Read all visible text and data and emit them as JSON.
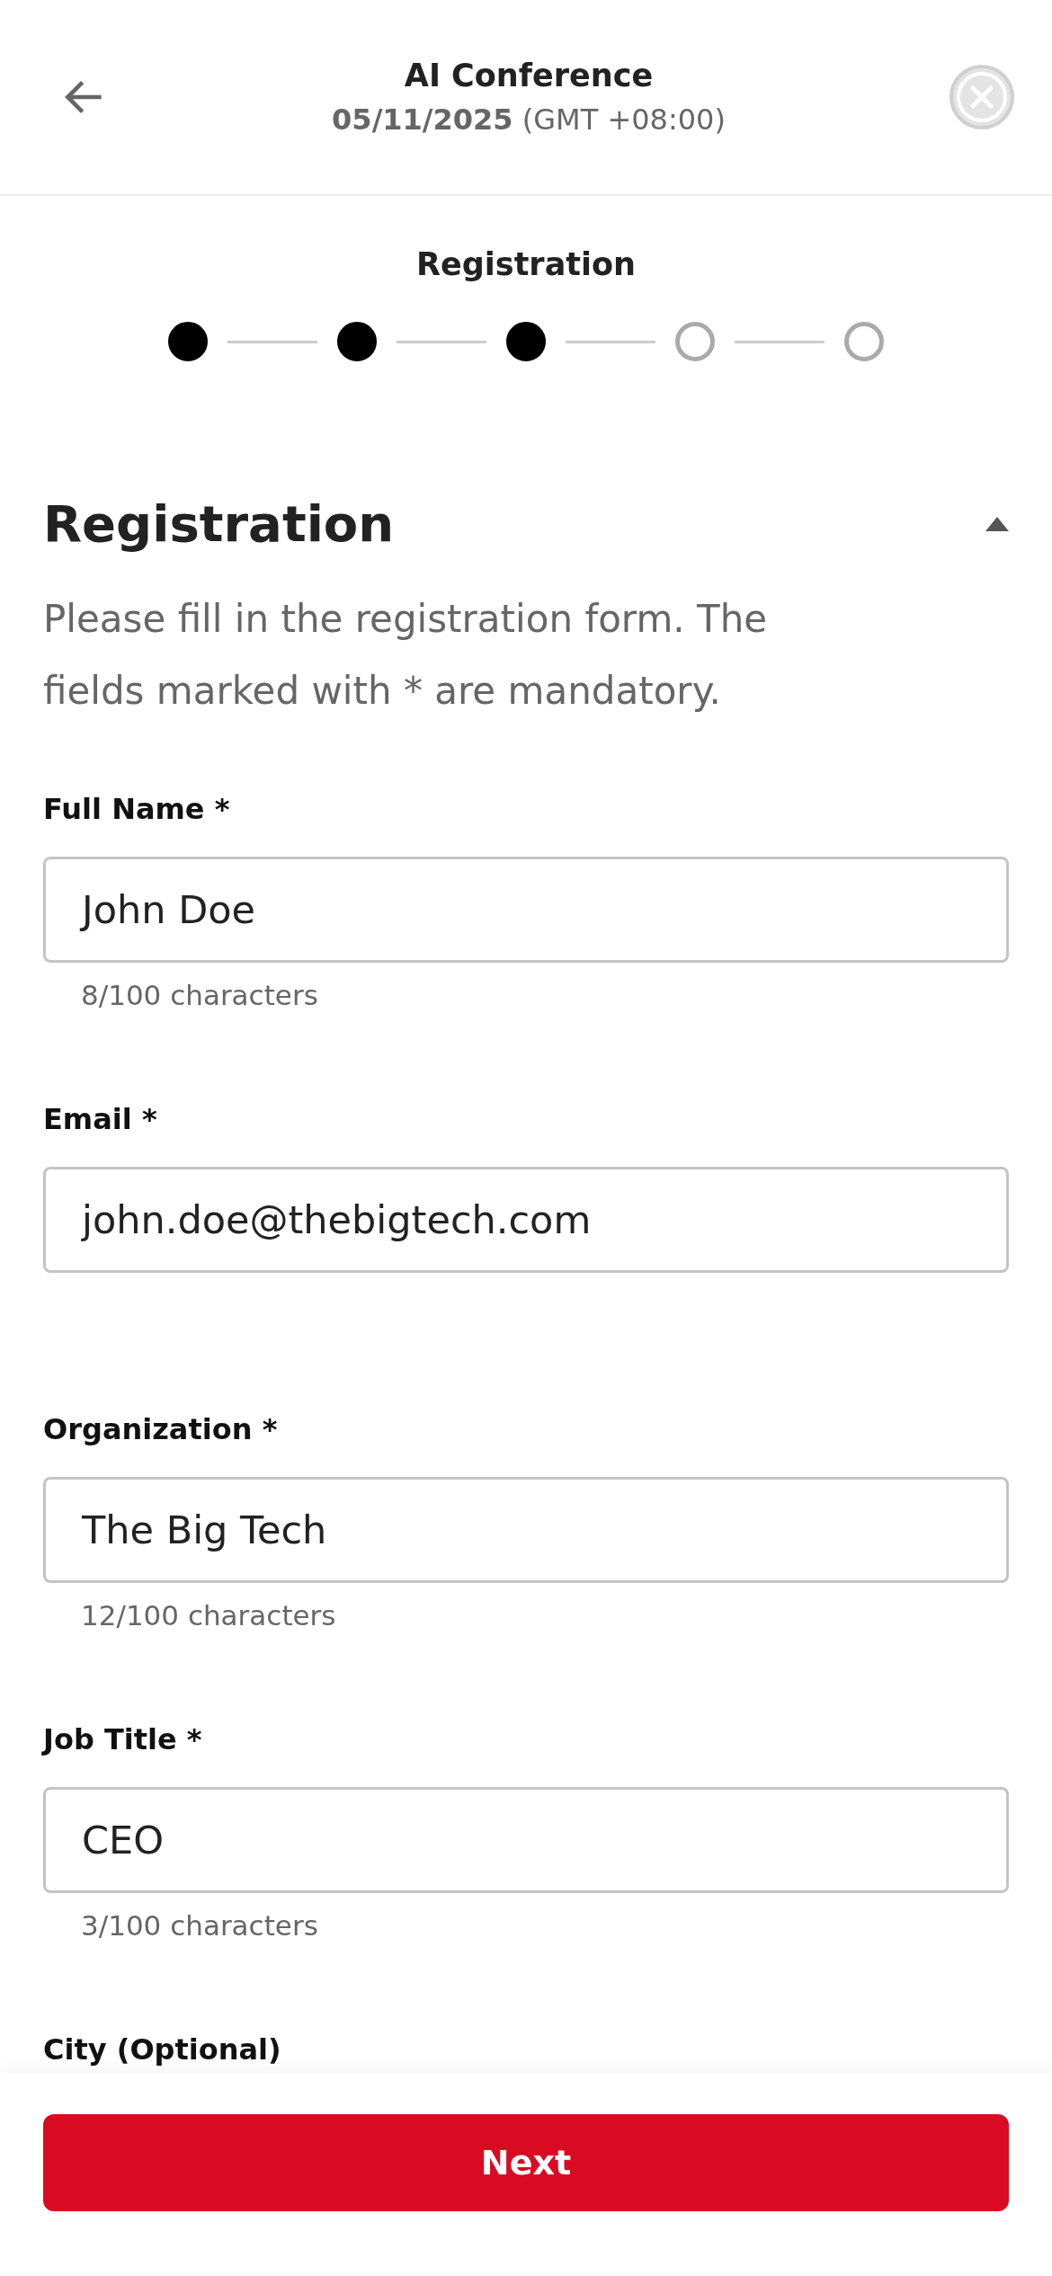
{
  "header": {
    "title": "AI Conference",
    "date": "05/11/2025",
    "timezone": "(GMT +08:00)"
  },
  "progress": {
    "title": "Registration",
    "steps": [
      {
        "completed": true
      },
      {
        "completed": true
      },
      {
        "completed": true
      },
      {
        "completed": false
      },
      {
        "completed": false
      }
    ]
  },
  "section": {
    "title": "Registration",
    "expanded": true,
    "description": "Please fill in the registration form. The fields marked with * are mandatory."
  },
  "fields": [
    {
      "label": "Full Name *",
      "value": "John Doe",
      "helper": "8/100 characters"
    },
    {
      "label": "Email *",
      "value": "john.doe@thebigtech.com"
    },
    {
      "label": "Organization *",
      "value": "The Big Tech",
      "helper": "12/100 characters"
    },
    {
      "label": "Job Title *",
      "value": "CEO",
      "helper": "3/100 characters"
    },
    {
      "label": "City (Optional)"
    }
  ],
  "footer": {
    "button": "Next"
  }
}
